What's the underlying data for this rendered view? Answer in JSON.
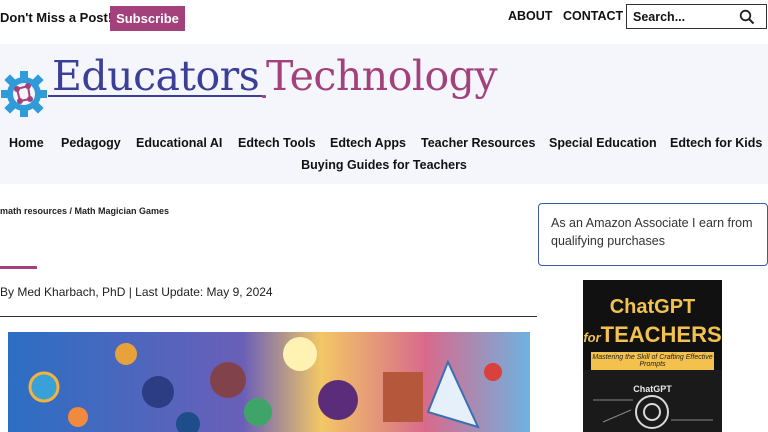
{
  "topbar": {
    "promo_text": "Don't Miss a Post!",
    "subscribe_label": "Subscribe",
    "links": [
      "ABOUT",
      "CONTACT"
    ],
    "search_placeholder": "Search..."
  },
  "logo": {
    "text_part1": "Educators",
    "text_part2": "Technology"
  },
  "nav": {
    "items": [
      "Home",
      "Pedagogy",
      "Educational AI",
      "Edtech Tools",
      "Edtech Apps",
      "Teacher Resources",
      "Special Education",
      "Edtech for Kids"
    ],
    "row2": "Buying Guides for Teachers"
  },
  "article": {
    "breadcrumb": "math resources / Math Magician Games",
    "byline": "By Med Kharbach, PhD | Last Update: May 9, 2024"
  },
  "sidebar": {
    "disclosure": "As an Amazon Associate I earn from qualifying purchases",
    "book": {
      "title_line1": "ChatGPT",
      "title_for": "for",
      "title_line2": "TEACHERS",
      "subtitle": "Mastering the Skill of Crafting Effective Prompts",
      "label": "ChatGPT"
    }
  },
  "colors": {
    "brand_purple": "#a3417d",
    "brand_blue": "#3b3f97",
    "book_gold": "#f2c14e"
  }
}
